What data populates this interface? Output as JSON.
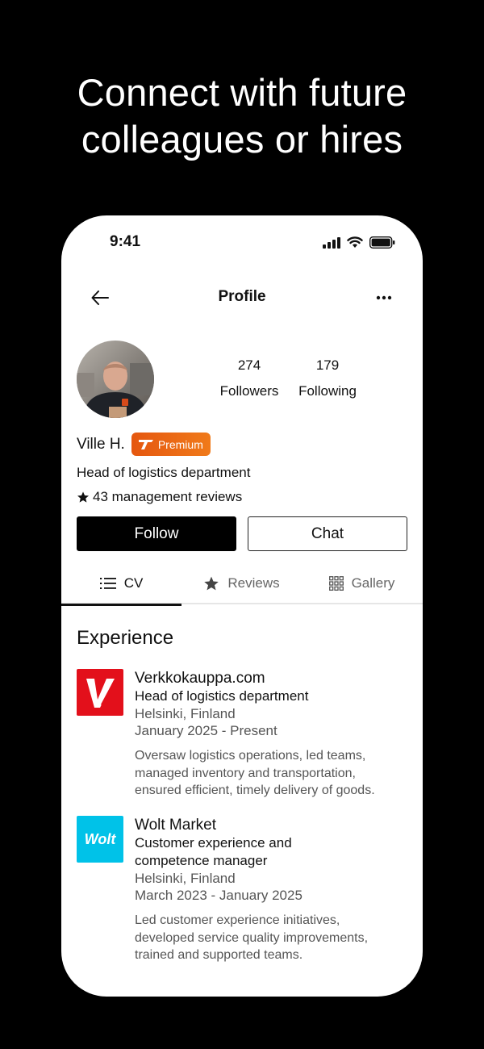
{
  "headline": {
    "line1": "Connect with future",
    "line2": "colleagues or hires"
  },
  "status_bar": {
    "time": "9:41",
    "icons": [
      "signal-icon",
      "wifi-icon",
      "battery-icon"
    ]
  },
  "navbar": {
    "title": "Profile",
    "back_icon": "arrow-left-icon",
    "more_icon": "more-icon"
  },
  "profile": {
    "name": "Ville H.",
    "badge": "Premium",
    "followers_count": "274",
    "followers_label": "Followers",
    "following_count": "179",
    "following_label": "Following",
    "title": "Head of logistics department",
    "reviews": "43 management reviews"
  },
  "actions": {
    "follow": "Follow",
    "chat": "Chat"
  },
  "tabs": [
    {
      "label": "CV",
      "icon": "list-icon",
      "active": true
    },
    {
      "label": "Reviews",
      "icon": "star-icon",
      "active": false
    },
    {
      "label": "Gallery",
      "icon": "grid-icon",
      "active": false
    }
  ],
  "experience": {
    "title": "Experience",
    "items": [
      {
        "company": "Verkkokauppa.com",
        "role": "Head of logistics department",
        "location": "Helsinki, Finland",
        "dates": "January 2025 - Present",
        "description_lines": [
          "Oversaw logistics operations, led teams,",
          "managed inventory and transportation,",
          "ensured efficient, timely delivery of goods."
        ],
        "logo_color": "#e3101b"
      },
      {
        "company": "Wolt Market",
        "role_lines": [
          "Customer experience and",
          "competence manager"
        ],
        "location": "Helsinki, Finland",
        "dates": "March 2023 - January 2025",
        "description_lines": [
          "Led customer experience initiatives,",
          "developed service quality improvements,",
          "trained and supported teams."
        ],
        "logo_text": "Wolt",
        "logo_color": "#00c2e8"
      }
    ]
  },
  "colors": {
    "premium_start": "#e5570f",
    "premium_end": "#f07a1a",
    "background": "#000000"
  }
}
